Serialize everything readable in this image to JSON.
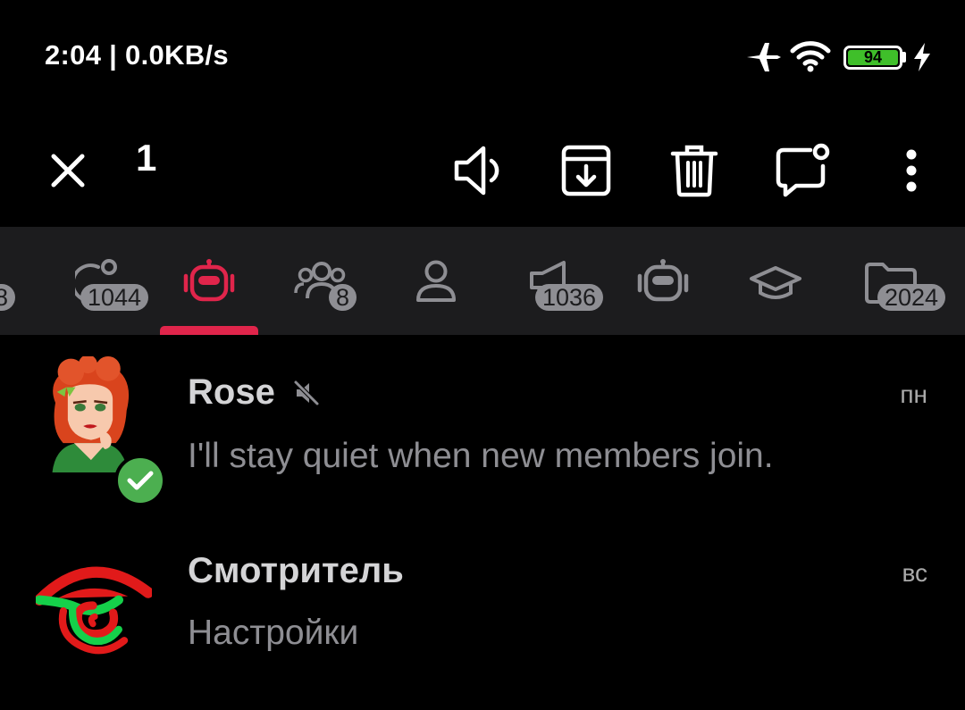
{
  "status_bar": {
    "time_speed": "2:04 | 0.0KB/s",
    "battery_level": "94",
    "icons": [
      "airplane-icon",
      "wifi-icon",
      "battery-icon",
      "charging-icon"
    ]
  },
  "action_bar": {
    "selected_count": "1",
    "actions": [
      "close-icon",
      "unmute-icon",
      "archive-icon",
      "delete-icon",
      "mark-unread-icon",
      "more-icon"
    ]
  },
  "tabs": {
    "items": [
      {
        "icon": "partial-tab-icon",
        "badge": "8"
      },
      {
        "icon": "chats-icon",
        "badge": "1044"
      },
      {
        "icon": "bots-icon",
        "badge": "",
        "active": true
      },
      {
        "icon": "groups-icon",
        "badge": "8"
      },
      {
        "icon": "contacts-icon",
        "badge": ""
      },
      {
        "icon": "channels-icon",
        "badge": "1036"
      },
      {
        "icon": "bot-outline-icon",
        "badge": ""
      },
      {
        "icon": "graduation-cap-icon",
        "badge": ""
      },
      {
        "icon": "folder-icon",
        "badge": "2024"
      }
    ],
    "active_color": "#e0254b"
  },
  "chats": [
    {
      "name": "Rose",
      "muted": true,
      "message": "I'll stay quiet when new members join.",
      "time": "пн",
      "verified": true
    },
    {
      "name": "Смотритель",
      "muted": false,
      "message": "Настройки",
      "time": "вс",
      "verified": false
    }
  ]
}
